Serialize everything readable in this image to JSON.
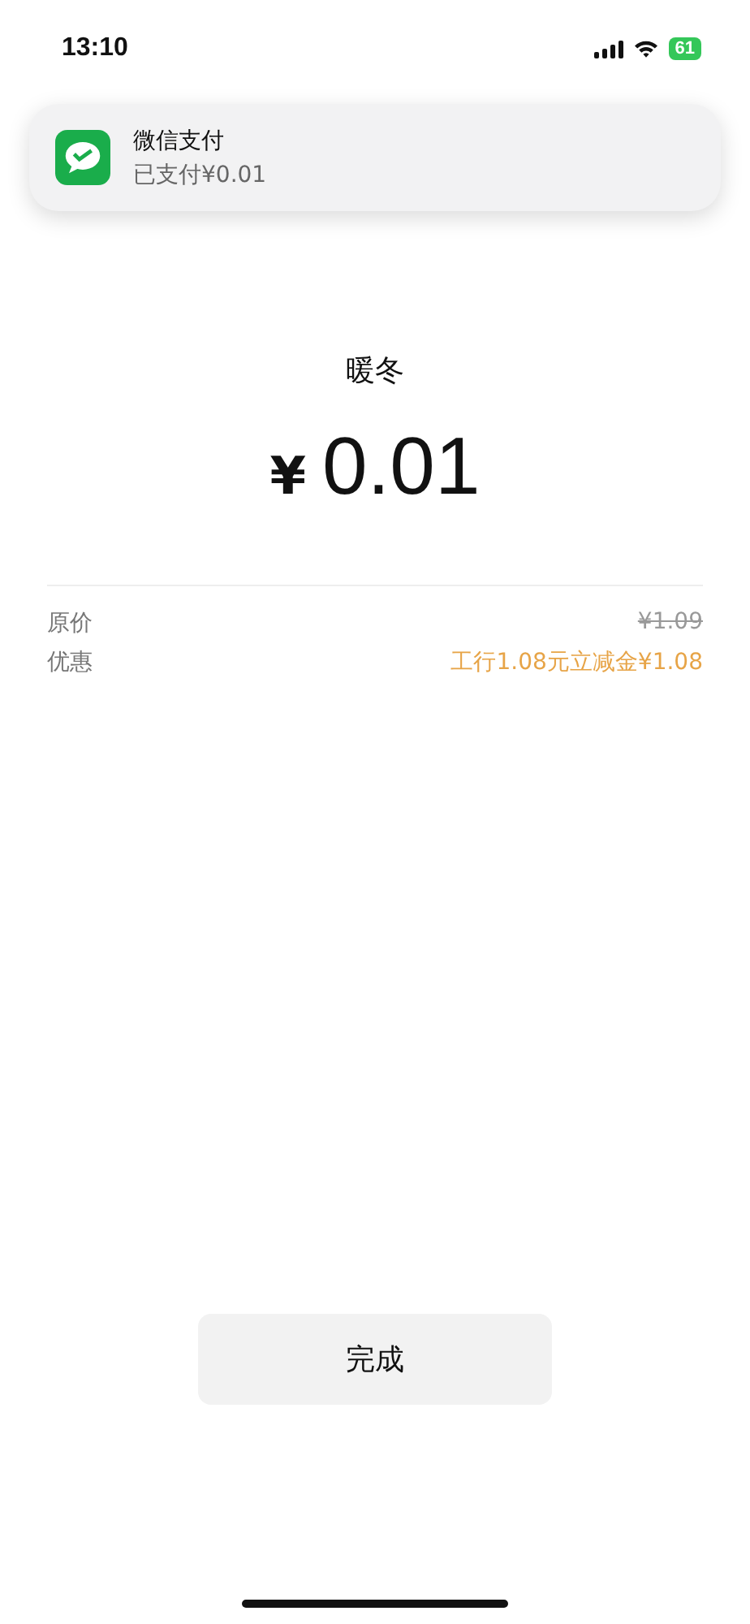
{
  "status_bar": {
    "time": "13:10",
    "battery": "61"
  },
  "notification": {
    "title": "微信支付",
    "body": "已支付¥0.01"
  },
  "merchant": "暖冬",
  "amount": {
    "currency": "¥",
    "value": "0.01"
  },
  "details": [
    {
      "label": "原价",
      "value": "¥1.09",
      "kind": "struck"
    },
    {
      "label": "优惠",
      "value": "工行1.08元立减金¥1.08",
      "kind": "discount"
    }
  ],
  "done_button": "完成"
}
